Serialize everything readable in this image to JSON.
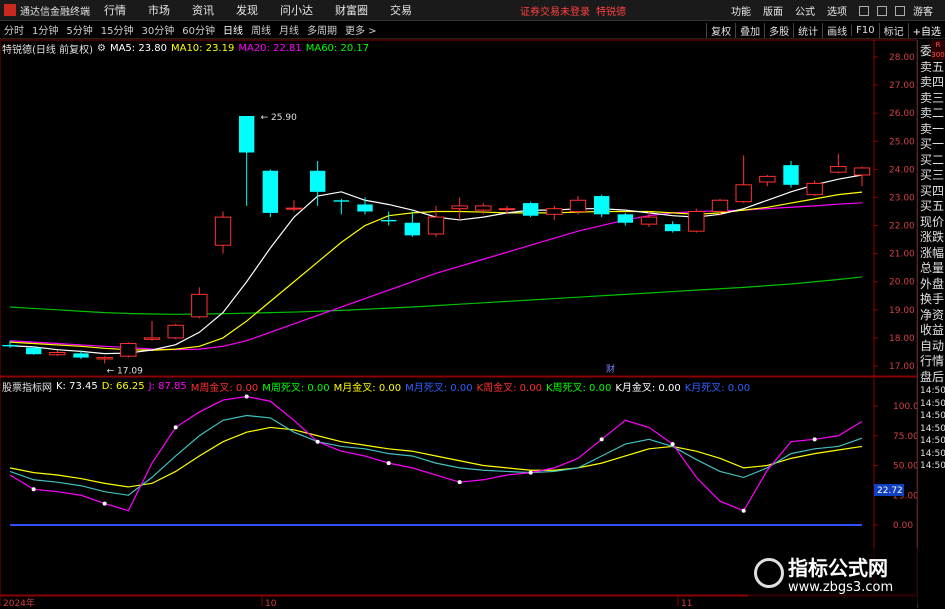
{
  "menubar": {
    "app_name": "通达信金融终端",
    "items": [
      "行情",
      "市场",
      "资讯",
      "发现",
      "问小达",
      "财富圈",
      "交易"
    ],
    "login_status": "证券交易未登录",
    "stock_name": "特锐德",
    "right_items": [
      "功能",
      "版面",
      "公式",
      "选项"
    ],
    "guest": "游客"
  },
  "periods": [
    "分时",
    "1分钟",
    "5分钟",
    "15分钟",
    "30分钟",
    "60分钟",
    "日线",
    "周线",
    "月线",
    "多周期",
    "更多 >"
  ],
  "active_period": "日线",
  "toolbar": [
    "复权",
    "叠加",
    "多股",
    "统计",
    "画线",
    "F10",
    "标记",
    "+自选"
  ],
  "main_info": {
    "title": "特锐德(日线 前复权)",
    "ma5": "MA5: 23.80",
    "ma10": "MA10: 23.19",
    "ma20": "MA20: 22.81",
    "ma60": "MA60: 20.17",
    "high_label": "25.90",
    "low_label": "17.09",
    "cai_label": "财"
  },
  "sub_info": {
    "title": "股票指标网",
    "k": "K: 73.45",
    "d": "D: 66.25",
    "j": "J: 87.85",
    "signals": [
      "M周金叉: 0.00",
      "M周死叉: 0.00",
      "M月金叉: 0.00",
      "M月死叉: 0.00",
      "K周金叉: 0.00",
      "K周死叉: 0.00",
      "K月金叉: 0.00",
      "K月死叉: 0.00"
    ],
    "last_value": "22.72"
  },
  "main_axis": [
    "28.00",
    "27.00",
    "26.00",
    "25.00",
    "24.00",
    "23.00",
    "22.00",
    "21.00",
    "20.00",
    "19.00",
    "18.00",
    "17.00"
  ],
  "sub_axis": [
    "100.0",
    "75.00",
    "50.00",
    "25.00",
    "0.00"
  ],
  "date_labels": [
    "2024年",
    "10",
    "11"
  ],
  "sidebar": [
    "委比",
    "卖五",
    "卖四",
    "卖三",
    "卖二",
    "卖一",
    "买一",
    "买二",
    "买三",
    "买四",
    "买五",
    "现价",
    "涨跌",
    "涨幅",
    "总量",
    "外盘",
    "换手",
    "净资",
    "收益",
    "自动",
    "行情",
    "盘后",
    "14:50",
    "14:50",
    "14:50",
    "14:50",
    "14:50",
    "14:50",
    "14:50"
  ],
  "side_tag": "R 300",
  "watermark": {
    "title": "指标公式网",
    "url": "www.zbgs3.com"
  },
  "colors": {
    "up": "#ff3232",
    "down": "#00ffff",
    "ma5": "#ffffff",
    "ma10": "#ffff00",
    "ma20": "#ff00ff",
    "ma60": "#00c000",
    "k": "#ffffff",
    "d": "#ffff00",
    "j": "#ff00ff"
  },
  "chart_data": {
    "type": "candlestick",
    "candles": [
      {
        "o": 17.75,
        "h": 17.9,
        "l": 17.65,
        "c": 17.7
      },
      {
        "o": 17.65,
        "h": 17.7,
        "l": 17.4,
        "c": 17.42
      },
      {
        "o": 17.4,
        "h": 17.55,
        "l": 17.35,
        "c": 17.48
      },
      {
        "o": 17.45,
        "h": 17.55,
        "l": 17.25,
        "c": 17.3
      },
      {
        "o": 17.25,
        "h": 17.35,
        "l": 17.09,
        "c": 17.3
      },
      {
        "o": 17.35,
        "h": 17.85,
        "l": 17.3,
        "c": 17.8
      },
      {
        "o": 17.95,
        "h": 18.6,
        "l": 17.9,
        "c": 18.0
      },
      {
        "o": 18.0,
        "h": 18.5,
        "l": 17.95,
        "c": 18.45
      },
      {
        "o": 18.75,
        "h": 19.8,
        "l": 18.7,
        "c": 19.55
      },
      {
        "o": 21.3,
        "h": 22.5,
        "l": 21.0,
        "c": 22.3
      },
      {
        "o": 25.9,
        "h": 25.9,
        "l": 22.7,
        "c": 24.6
      },
      {
        "o": 23.95,
        "h": 24.0,
        "l": 22.3,
        "c": 22.45
      },
      {
        "o": 22.6,
        "h": 22.9,
        "l": 22.5,
        "c": 22.62
      },
      {
        "o": 23.95,
        "h": 24.3,
        "l": 22.7,
        "c": 23.2
      },
      {
        "o": 22.9,
        "h": 22.95,
        "l": 22.4,
        "c": 22.85
      },
      {
        "o": 22.75,
        "h": 23.0,
        "l": 22.4,
        "c": 22.5
      },
      {
        "o": 22.2,
        "h": 22.5,
        "l": 22.0,
        "c": 22.15
      },
      {
        "o": 22.1,
        "h": 22.5,
        "l": 21.6,
        "c": 21.65
      },
      {
        "o": 21.7,
        "h": 22.7,
        "l": 21.6,
        "c": 22.3
      },
      {
        "o": 22.6,
        "h": 23.0,
        "l": 22.2,
        "c": 22.7
      },
      {
        "o": 22.55,
        "h": 22.8,
        "l": 22.4,
        "c": 22.7
      },
      {
        "o": 22.6,
        "h": 22.7,
        "l": 22.4,
        "c": 22.6
      },
      {
        "o": 22.8,
        "h": 22.85,
        "l": 22.3,
        "c": 22.35
      },
      {
        "o": 22.4,
        "h": 22.7,
        "l": 22.2,
        "c": 22.6
      },
      {
        "o": 22.5,
        "h": 23.05,
        "l": 22.4,
        "c": 22.9
      },
      {
        "o": 23.05,
        "h": 23.1,
        "l": 22.3,
        "c": 22.4
      },
      {
        "o": 22.4,
        "h": 22.45,
        "l": 22.0,
        "c": 22.1
      },
      {
        "o": 22.05,
        "h": 22.5,
        "l": 21.95,
        "c": 22.3
      },
      {
        "o": 22.05,
        "h": 22.15,
        "l": 21.75,
        "c": 21.8
      },
      {
        "o": 21.8,
        "h": 22.6,
        "l": 21.75,
        "c": 22.5
      },
      {
        "o": 22.5,
        "h": 22.95,
        "l": 22.35,
        "c": 22.9
      },
      {
        "o": 22.85,
        "h": 24.5,
        "l": 22.8,
        "c": 23.45
      },
      {
        "o": 23.55,
        "h": 23.8,
        "l": 23.4,
        "c": 23.75
      },
      {
        "o": 24.15,
        "h": 24.3,
        "l": 23.35,
        "c": 23.45
      },
      {
        "o": 23.1,
        "h": 23.6,
        "l": 23.05,
        "c": 23.5
      },
      {
        "o": 23.9,
        "h": 24.55,
        "l": 23.85,
        "c": 24.1
      },
      {
        "o": 23.8,
        "h": 24.1,
        "l": 23.4,
        "c": 24.05
      }
    ],
    "ma5": [
      17.72,
      17.68,
      17.58,
      17.52,
      17.44,
      17.46,
      17.57,
      17.76,
      18.2,
      18.9,
      20.0,
      21.2,
      22.3,
      23.05,
      23.2,
      22.9,
      22.75,
      22.55,
      22.3,
      22.2,
      22.3,
      22.45,
      22.55,
      22.55,
      22.6,
      22.6,
      22.55,
      22.45,
      22.35,
      22.3,
      22.4,
      22.6,
      22.9,
      23.2,
      23.45,
      23.65,
      23.8
    ],
    "ma10": [
      17.85,
      17.8,
      17.75,
      17.7,
      17.63,
      17.58,
      17.56,
      17.6,
      17.7,
      18.0,
      18.6,
      19.3,
      20.0,
      20.7,
      21.4,
      22.0,
      22.35,
      22.45,
      22.5,
      22.5,
      22.48,
      22.45,
      22.45,
      22.45,
      22.48,
      22.5,
      22.5,
      22.5,
      22.45,
      22.4,
      22.45,
      22.55,
      22.65,
      22.8,
      22.95,
      23.1,
      23.19
    ],
    "ma20": [
      17.9,
      17.85,
      17.8,
      17.75,
      17.7,
      17.66,
      17.6,
      17.58,
      17.6,
      17.7,
      17.9,
      18.2,
      18.5,
      18.8,
      19.1,
      19.4,
      19.7,
      20.0,
      20.3,
      20.55,
      20.8,
      21.05,
      21.3,
      21.55,
      21.8,
      22.0,
      22.2,
      22.35,
      22.45,
      22.5,
      22.52,
      22.55,
      22.6,
      22.65,
      22.7,
      22.76,
      22.81
    ],
    "ma60": [
      19.1,
      19.05,
      19.0,
      18.95,
      18.9,
      18.87,
      18.85,
      18.84,
      18.85,
      18.86,
      18.88,
      18.9,
      18.92,
      18.95,
      18.98,
      19.02,
      19.06,
      19.1,
      19.15,
      19.2,
      19.25,
      19.3,
      19.35,
      19.4,
      19.45,
      19.5,
      19.55,
      19.6,
      19.65,
      19.7,
      19.75,
      19.8,
      19.86,
      19.92,
      20.0,
      20.08,
      20.17
    ],
    "k": [
      45,
      38,
      36,
      33,
      28,
      25,
      40,
      58,
      75,
      88,
      92,
      90,
      78,
      70,
      66,
      64,
      60,
      58,
      52,
      48,
      46,
      45,
      44,
      45,
      48,
      58,
      68,
      72,
      66,
      55,
      45,
      40,
      48,
      60,
      64,
      66,
      73
    ],
    "d": [
      48,
      44,
      42,
      39,
      35,
      32,
      35,
      45,
      58,
      70,
      78,
      82,
      80,
      75,
      70,
      67,
      64,
      62,
      58,
      54,
      50,
      48,
      46,
      46,
      48,
      52,
      58,
      64,
      66,
      62,
      56,
      48,
      50,
      56,
      60,
      63,
      66
    ],
    "j": [
      42,
      30,
      28,
      25,
      18,
      12,
      52,
      82,
      95,
      105,
      108,
      104,
      88,
      70,
      62,
      58,
      52,
      48,
      42,
      36,
      38,
      42,
      44,
      48,
      56,
      72,
      88,
      82,
      68,
      40,
      20,
      12,
      46,
      70,
      72,
      75,
      87
    ]
  }
}
